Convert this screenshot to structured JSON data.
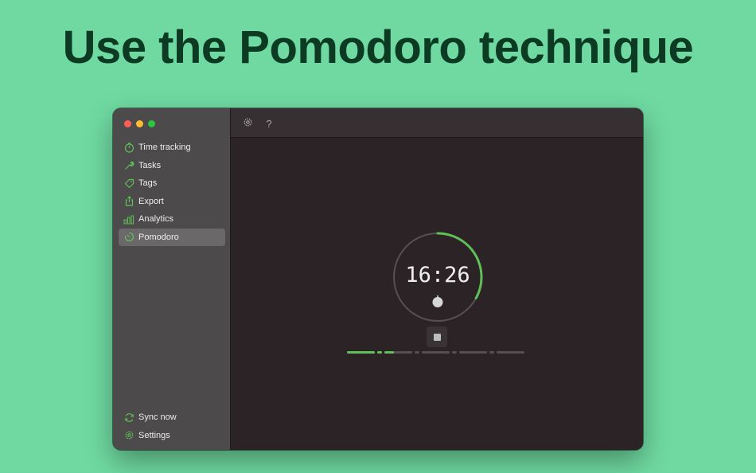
{
  "headline": "Use the Pomodoro technique",
  "colors": {
    "accent_green": "#5fc057",
    "background": "#6fd9a1",
    "headline": "#0c3a23",
    "sidebar": "#4d4a4b",
    "content": "#2b2326"
  },
  "sidebar": {
    "items": [
      {
        "label": "Time tracking",
        "icon": "stopwatch-icon"
      },
      {
        "label": "Tasks",
        "icon": "wrench-icon"
      },
      {
        "label": "Tags",
        "icon": "tag-icon"
      },
      {
        "label": "Export",
        "icon": "share-icon"
      },
      {
        "label": "Analytics",
        "icon": "bar-chart-icon"
      },
      {
        "label": "Pomodoro",
        "icon": "timer-icon",
        "active": true
      }
    ],
    "bottom_items": [
      {
        "label": "Sync now",
        "icon": "sync-icon"
      },
      {
        "label": "Settings",
        "icon": "gear-icon"
      }
    ]
  },
  "toolbar": {
    "settings_icon": "gear-icon",
    "help_label": "?"
  },
  "timer": {
    "time": "16:26",
    "ring_progress": 0.33,
    "phase_icon": "tomato-icon"
  },
  "session_progress": {
    "segments": [
      {
        "type": "focus",
        "progress": 1.0
      },
      {
        "type": "break",
        "progress": 1.0
      },
      {
        "type": "focus",
        "progress": 0.35
      },
      {
        "type": "break",
        "progress": 0
      },
      {
        "type": "focus",
        "progress": 0
      },
      {
        "type": "break",
        "progress": 0
      },
      {
        "type": "focus",
        "progress": 0
      },
      {
        "type": "break",
        "progress": 0
      },
      {
        "type": "focus",
        "progress": 0
      }
    ]
  }
}
